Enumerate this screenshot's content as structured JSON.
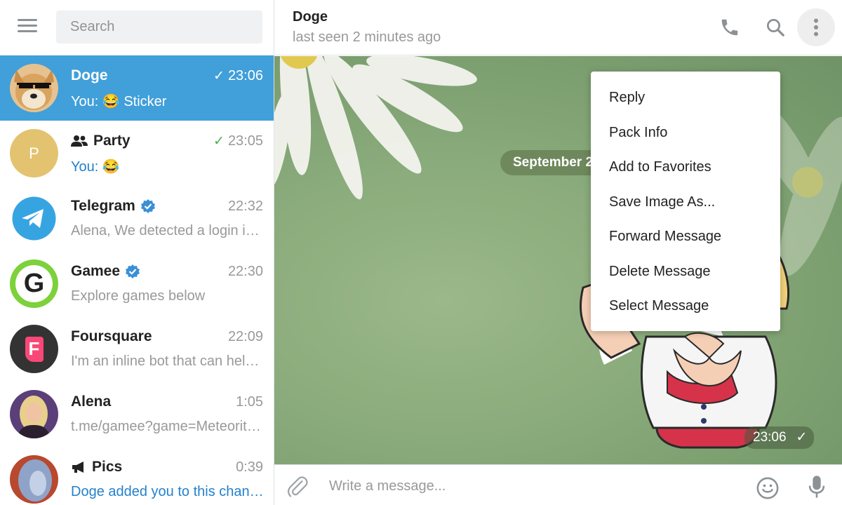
{
  "sidebar": {
    "search_placeholder": "Search",
    "chats": [
      {
        "name": "Doge",
        "time": "23:06",
        "preview": "You: 😂 Sticker",
        "read": true,
        "active": true
      },
      {
        "name": "Party",
        "time": "23:05",
        "preview": "You: 😂",
        "read": true,
        "type": "group"
      },
      {
        "name": "Telegram",
        "time": "22:32",
        "preview": "Alena,  We detected a login into your account",
        "verified": true
      },
      {
        "name": "Gamee",
        "time": "22:30",
        "preview": "Explore games below",
        "verified": true
      },
      {
        "name": "Foursquare",
        "time": "22:09",
        "preview": "I'm an inline bot that can help you find places",
        "avatar_letter": "F"
      },
      {
        "name": "Alena",
        "time": "1:05",
        "preview": "t.me/gamee?game=MeteoriteAttack"
      },
      {
        "name": "Pics",
        "time": "0:39",
        "preview": "Doge added you to this channel",
        "type": "channel"
      }
    ],
    "party_avatar_letter": "P",
    "gamee_avatar_letter": "G"
  },
  "header": {
    "name": "Doge",
    "status": "last seen 2 minutes ago",
    "icons": [
      "phone-icon",
      "search-icon",
      "more-vertical-icon"
    ]
  },
  "messages": {
    "date_label": "September 2",
    "sticker_time": "23:06"
  },
  "context_menu": {
    "items": [
      "Reply",
      "Pack Info",
      "Add to Favorites",
      "Save Image As...",
      "Forward Message",
      "Delete Message",
      "Select Message"
    ]
  },
  "composer": {
    "placeholder": "Write a message...",
    "icons": [
      "paperclip-icon",
      "smile-icon",
      "microphone-icon"
    ]
  },
  "colors": {
    "accent": "#419fd9",
    "link": "#2481cc",
    "read_tick": "#4fae4e",
    "verified": "#3a8fd6"
  }
}
